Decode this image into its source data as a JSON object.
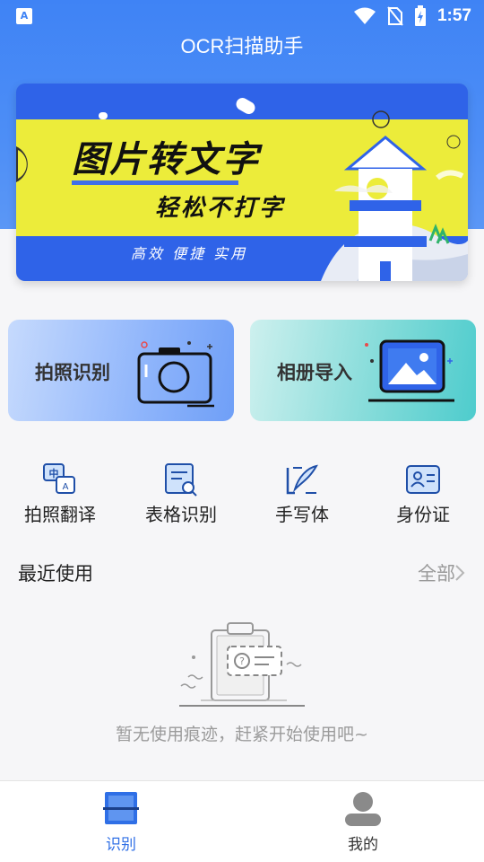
{
  "status_bar": {
    "time": "1:57",
    "left_icon": "A",
    "icons": [
      "wifi-icon",
      "no-sim-icon",
      "battery-charging-icon"
    ]
  },
  "header": {
    "title": "OCR扫描助手"
  },
  "banner": {
    "title": "图片转文字",
    "subtitle": "轻松不打字",
    "slogan": "高效 便捷 实用"
  },
  "main_actions": {
    "photo_label": "拍照识别",
    "album_label": "相册导入"
  },
  "quick_tools": [
    {
      "label": "拍照翻译",
      "icon": "translate-icon"
    },
    {
      "label": "表格识别",
      "icon": "table-scan-icon"
    },
    {
      "label": "手写体",
      "icon": "handwriting-icon"
    },
    {
      "label": "身份证",
      "icon": "id-card-icon"
    }
  ],
  "recent": {
    "title": "最近使用",
    "see_all": "全部",
    "empty_text": "暂无使用痕迹，赶紧开始使用吧~"
  },
  "bottom_nav": [
    {
      "label": "识别",
      "active": true
    },
    {
      "label": "我的",
      "active": false
    }
  ],
  "colors": {
    "primary": "#3f83f5",
    "active_tab": "#2f6fe6",
    "banner_yellow": "#ecec3a"
  }
}
